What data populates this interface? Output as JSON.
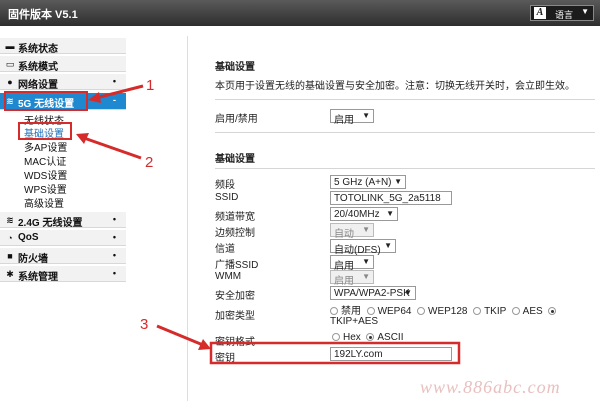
{
  "header": {
    "firmware": "固件版本 V5.1",
    "language_label": "语言"
  },
  "sidebar": {
    "items": [
      {
        "label": "系统状态",
        "icon": "monitor-icon",
        "dot": ""
      },
      {
        "label": "系统模式",
        "icon": "window-icon",
        "dot": ""
      },
      {
        "label": "网络设置",
        "icon": "globe-icon",
        "dot": "•"
      },
      {
        "label": "5G 无线设置",
        "icon": "wifi-icon",
        "dot": "-"
      },
      {
        "label": "2.4G 无线设置",
        "icon": "wifi-icon",
        "dot": "•"
      },
      {
        "label": "QoS",
        "icon": "gauge-icon",
        "dot": "•"
      },
      {
        "label": "防火墙",
        "icon": "lock-icon",
        "dot": "•"
      },
      {
        "label": "系统管理",
        "icon": "gear-icon",
        "dot": "•"
      }
    ],
    "submenu": [
      "无线状态",
      "基础设置",
      "多AP设置",
      "MAC认证",
      "WDS设置",
      "WPS设置",
      "高级设置"
    ]
  },
  "main": {
    "title": "基础设置",
    "description": "本页用于设置无线的基础设置与安全加密。注意：切换无线开关时，会立即生效。",
    "enable_label": "启用/禁用",
    "enable_value": "启用",
    "section_title": "基础设置",
    "fields": {
      "band": {
        "label": "频段",
        "value": "5 GHz (A+N)"
      },
      "ssid": {
        "label": "SSID",
        "value": "TOTOLINK_5G_2a5118"
      },
      "bandwidth": {
        "label": "频道带宽",
        "value": "20/40MHz"
      },
      "sideband": {
        "label": "边频控制",
        "value": "自动"
      },
      "channel": {
        "label": "信道",
        "value": "自动(DFS)"
      },
      "broadcast": {
        "label": "广播SSID",
        "value": "启用"
      },
      "wmm": {
        "label": "WMM",
        "value": "启用"
      },
      "security": {
        "label": "安全加密",
        "value": "WPA/WPA2-PSK"
      },
      "cipher": {
        "label": "加密类型",
        "options": [
          "禁用",
          "WEP64",
          "WEP128",
          "TKIP",
          "AES",
          "TKIP+AES"
        ]
      },
      "key_format": {
        "label": "密钥格式",
        "options": [
          "Hex",
          "ASCII"
        ]
      },
      "key": {
        "label": "密钥",
        "value": "192LY.com"
      }
    }
  },
  "annotations": {
    "callouts": [
      "1",
      "2",
      "3"
    ],
    "color": "#d62b2b"
  },
  "watermark": "www.886abc.com",
  "colors": {
    "active_nav": "#1e88d0",
    "callout": "#d62b2b",
    "topbar": "#3a3a3a"
  }
}
